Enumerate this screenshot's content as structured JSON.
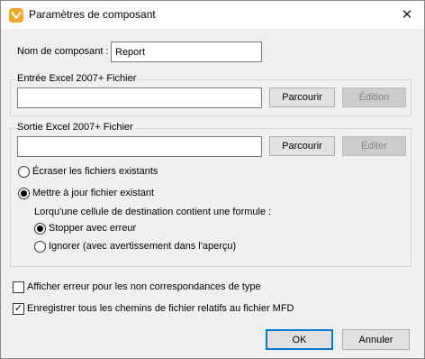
{
  "window": {
    "title": "Paramètres de composant",
    "close_glyph": "✕"
  },
  "component": {
    "label": "Nom de composant :",
    "value": "Report"
  },
  "input_group": {
    "title": "Entrée Excel 2007+ Fichier",
    "path_value": "",
    "browse_label": "Parcourir",
    "edit_label": "Édition"
  },
  "output_group": {
    "title": "Sortie Excel 2007+ Fichier",
    "path_value": "",
    "browse_label": "Parcourir",
    "edit_label": "Éditer",
    "overwrite_label": "Écraser les fichiers existants",
    "update_label": "Mettre à jour fichier existant",
    "formula_label": "Lorqu'une cellule de destination contient une formule :",
    "stop_label": "Stopper avec erreur",
    "ignore_label": "Ignorer (avec avertissement dans l'aperçu)"
  },
  "options": {
    "type_error_label": "Afficher erreur pour les non correspondances de type",
    "relative_paths_label": "Enregistrer tous les chemins de fichier relatifs au fichier MFD",
    "check_glyph": "✓"
  },
  "footer": {
    "ok_label": "OK",
    "cancel_label": "Annuler"
  },
  "state": {
    "mode": "update",
    "formula_mode": "stop",
    "type_error_checked": false,
    "relative_paths_checked": true
  },
  "colors": {
    "accent": "#0078d7",
    "icon_orange": "#f5a623"
  }
}
